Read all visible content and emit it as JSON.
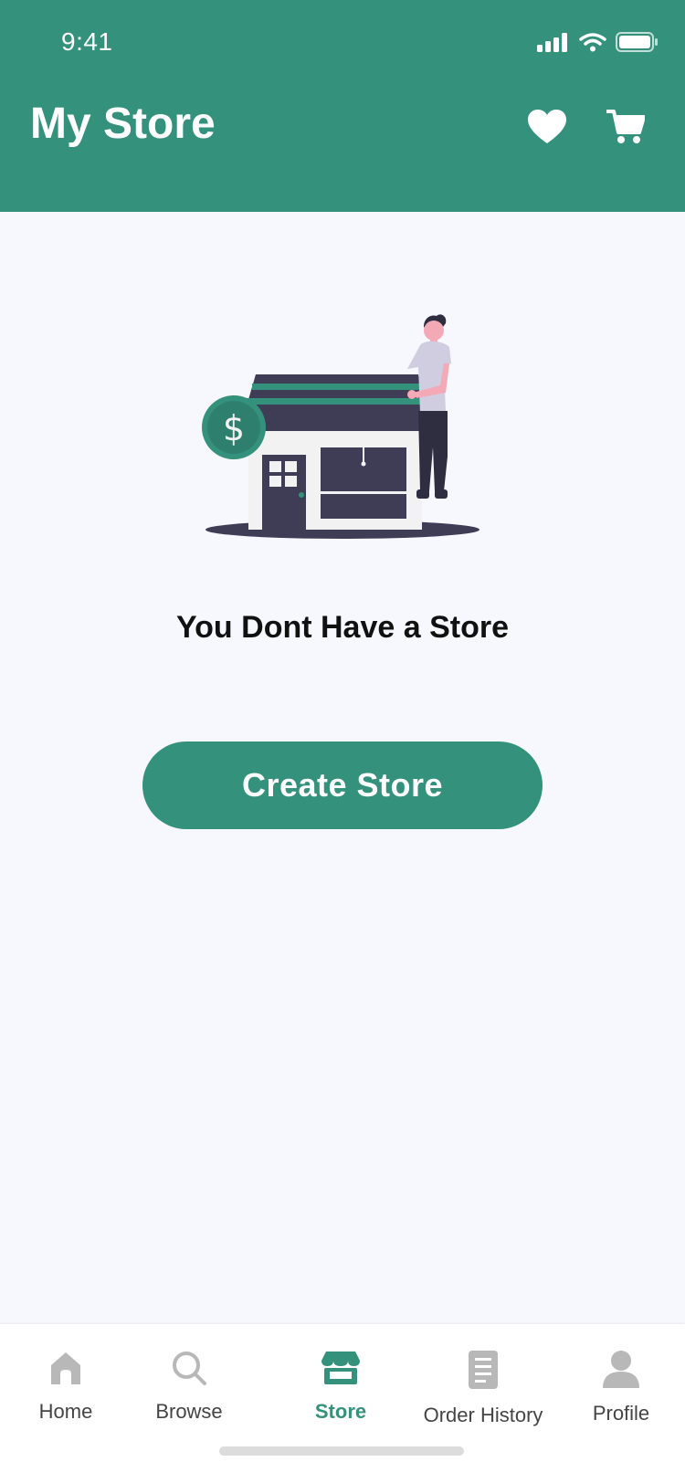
{
  "status_bar": {
    "time": "9:41"
  },
  "header": {
    "title": "My Store",
    "favorite_icon": "heart-icon",
    "cart_icon": "cart-icon"
  },
  "main": {
    "empty_text": "You Dont Have a Store",
    "cta_label": "Create Store"
  },
  "tabs": [
    {
      "label": "Home",
      "icon": "home-icon"
    },
    {
      "label": "Browse",
      "icon": "search-icon"
    },
    {
      "label": "Store",
      "icon": "store-icon",
      "active": true
    },
    {
      "label": "Order History",
      "icon": "list-icon"
    },
    {
      "label": "Profile",
      "icon": "person-icon"
    }
  ],
  "colors": {
    "accent": "#34917c",
    "dark": "#3f3d56",
    "background": "#f6f8fd",
    "inactive_icon": "#b8b8b8"
  }
}
